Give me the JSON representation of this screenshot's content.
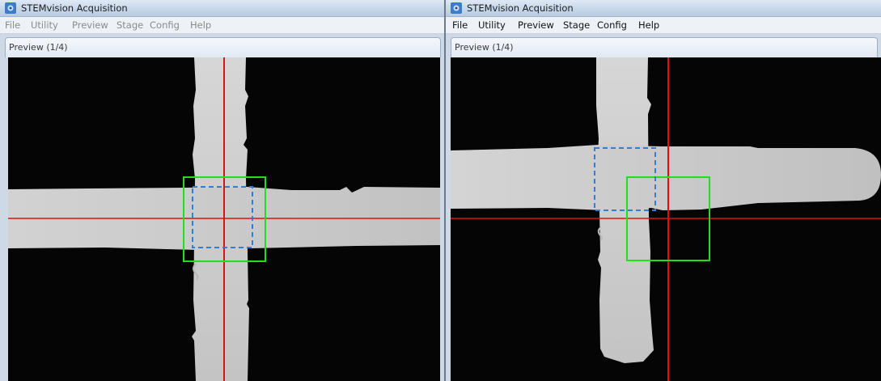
{
  "windows": [
    {
      "title": "STEMvision Acquisition",
      "menu": [
        "File",
        "Utility",
        "Preview",
        "Stage",
        "Config",
        "Help"
      ],
      "menu_enabled": false,
      "panel_label": "Preview (1/4)"
    },
    {
      "title": "STEMvision Acquisition",
      "menu": [
        "File",
        "Utility",
        "Preview",
        "Stage",
        "Config",
        "Help"
      ],
      "menu_enabled": true,
      "panel_label": "Preview (1/4)"
    }
  ],
  "colors": {
    "crosshair": "#e01010",
    "target_box": "#22dd22",
    "dashed_box": "#2f7fd6",
    "specimen": "#c9c9c9",
    "background": "#050505"
  }
}
